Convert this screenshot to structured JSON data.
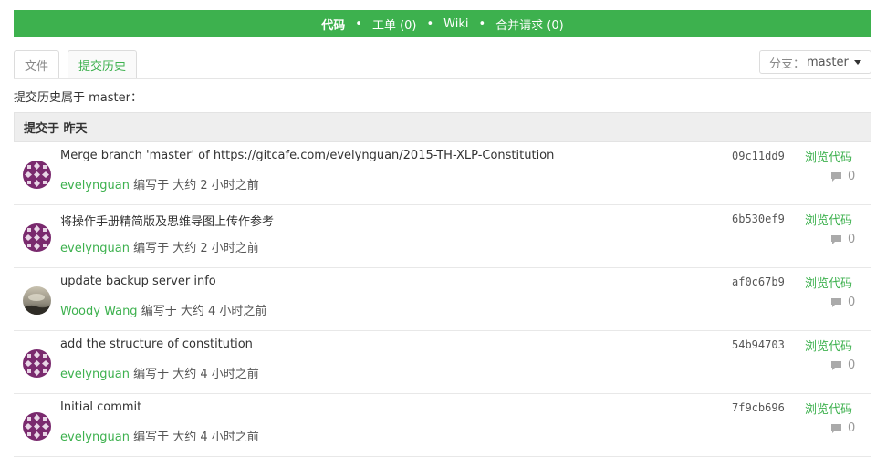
{
  "colors": {
    "brand": "#3db14e",
    "header_bg": "#eeeeee"
  },
  "nav": {
    "items": [
      {
        "label": "代码",
        "active": true
      },
      {
        "label": "工单 (0)",
        "active": false
      },
      {
        "label": "Wiki",
        "active": false
      },
      {
        "label": "合并请求 (0)",
        "active": false
      }
    ],
    "separator": "•"
  },
  "tabs": {
    "files": "文件",
    "history": "提交历史"
  },
  "branch": {
    "label": "分支：",
    "value": "master"
  },
  "history_title": "提交历史属于 master：",
  "group": {
    "title": "提交于 昨天"
  },
  "commits": [
    {
      "message": "Merge branch 'master' of https://gitcafe.com/evelynguan/2015-TH-XLP-Constitution",
      "author": "evelynguan",
      "time_text": "编写于 大约 2 小时之前",
      "sha": "09c11dd9",
      "browse": "浏览代码",
      "comments": "0",
      "avatar": "pattern-avatar"
    },
    {
      "message": "将操作手册精简版及思维导图上传作参考",
      "author": "evelynguan",
      "time_text": "编写于 大约 2 小时之前",
      "sha": "6b530ef9",
      "browse": "浏览代码",
      "comments": "0",
      "avatar": "pattern-avatar"
    },
    {
      "message": "update backup server info",
      "author": "Woody Wang",
      "time_text": "编写于 大约 4 小时之前",
      "sha": "af0c67b9",
      "browse": "浏览代码",
      "comments": "0",
      "avatar": "photo-avatar"
    },
    {
      "message": "add the structure of constitution",
      "author": "evelynguan",
      "time_text": "编写于 大约 4 小时之前",
      "sha": "54b94703",
      "browse": "浏览代码",
      "comments": "0",
      "avatar": "pattern-avatar"
    },
    {
      "message": "Initial commit",
      "author": "evelynguan",
      "time_text": "编写于 大约 4 小时之前",
      "sha": "7f9cb696",
      "browse": "浏览代码",
      "comments": "0",
      "avatar": "pattern-avatar"
    }
  ]
}
